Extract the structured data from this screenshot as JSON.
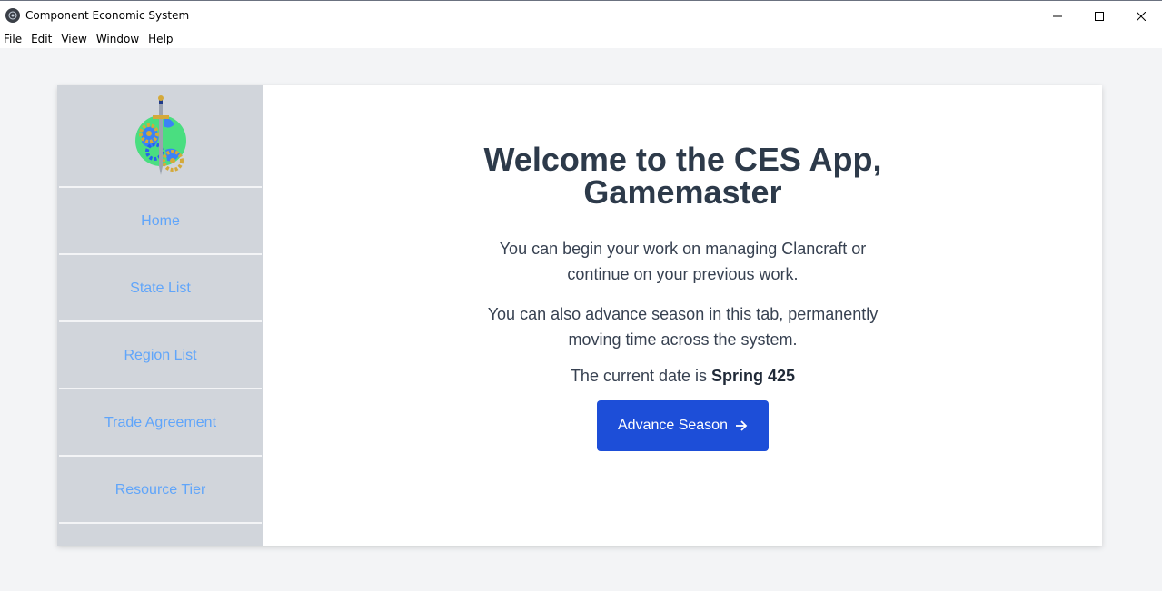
{
  "window": {
    "title": "Component Economic System"
  },
  "menu": [
    "File",
    "Edit",
    "View",
    "Window",
    "Help"
  ],
  "sidebar": {
    "items": [
      {
        "label": "Home"
      },
      {
        "label": "State List"
      },
      {
        "label": "Region List"
      },
      {
        "label": "Trade Agreement"
      },
      {
        "label": "Resource Tier"
      }
    ]
  },
  "main": {
    "welcome_line1": "Welcome to the CES App,",
    "welcome_line2": "Gamemaster",
    "paragraph1": "You can begin your work on managing Clancraft or continue on your previous work.",
    "paragraph2": "You can also advance season in this tab, permanently moving time across the system.",
    "date_prefix": "The current date is ",
    "date_value": "Spring 425",
    "advance_button": "Advance Season"
  },
  "colors": {
    "accent": "#1d4ed8",
    "link": "#60a5fa",
    "sidebar_bg": "#d1d5db",
    "heading": "#2d3a4a"
  },
  "icons": [
    "app-icon",
    "minimize-icon",
    "maximize-icon",
    "close-icon",
    "logo-icon",
    "arrow-right-icon"
  ]
}
